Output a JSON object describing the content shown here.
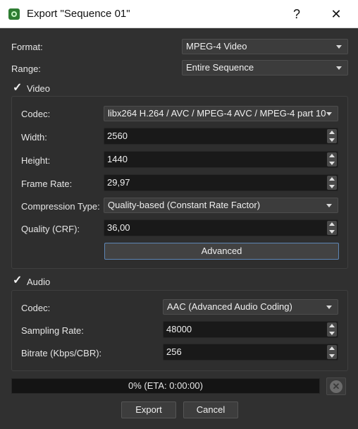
{
  "window": {
    "title": "Export \"Sequence 01\"",
    "help_glyph": "?",
    "close_glyph": "✕"
  },
  "format": {
    "label": "Format:",
    "value": "MPEG-4 Video"
  },
  "range": {
    "label": "Range:",
    "value": "Entire Sequence"
  },
  "video": {
    "checkbox_label": "Video",
    "checked": true,
    "codec": {
      "label": "Codec:",
      "value": "libx264 H.264 / AVC / MPEG-4 AVC / MPEG-4 part 10"
    },
    "width": {
      "label": "Width:",
      "value": "2560"
    },
    "height": {
      "label": "Height:",
      "value": "1440"
    },
    "frame_rate": {
      "label": "Frame Rate:",
      "value": "29,97"
    },
    "compression_type": {
      "label": "Compression Type:",
      "value": "Quality-based (Constant Rate Factor)"
    },
    "quality": {
      "label": "Quality (CRF):",
      "value": "36,00"
    },
    "advanced_button": "Advanced"
  },
  "audio": {
    "checkbox_label": "Audio",
    "checked": true,
    "codec": {
      "label": "Codec:",
      "value": "AAC (Advanced Audio Coding)"
    },
    "sampling_rate": {
      "label": "Sampling Rate:",
      "value": "48000"
    },
    "bitrate": {
      "label": "Bitrate (Kbps/CBR):",
      "value": "256"
    }
  },
  "progress": {
    "text": "0% (ETA: 0:00:00)",
    "fraction": 0
  },
  "buttons": {
    "export": "Export",
    "cancel": "Cancel"
  },
  "check_glyph": "✓",
  "cancel_progress_glyph": "✕",
  "colors": {
    "titlebar_bg": "#ffffff",
    "dialog_bg": "#303030",
    "field_bg": "#191919",
    "accent_border": "#5e86b5"
  }
}
